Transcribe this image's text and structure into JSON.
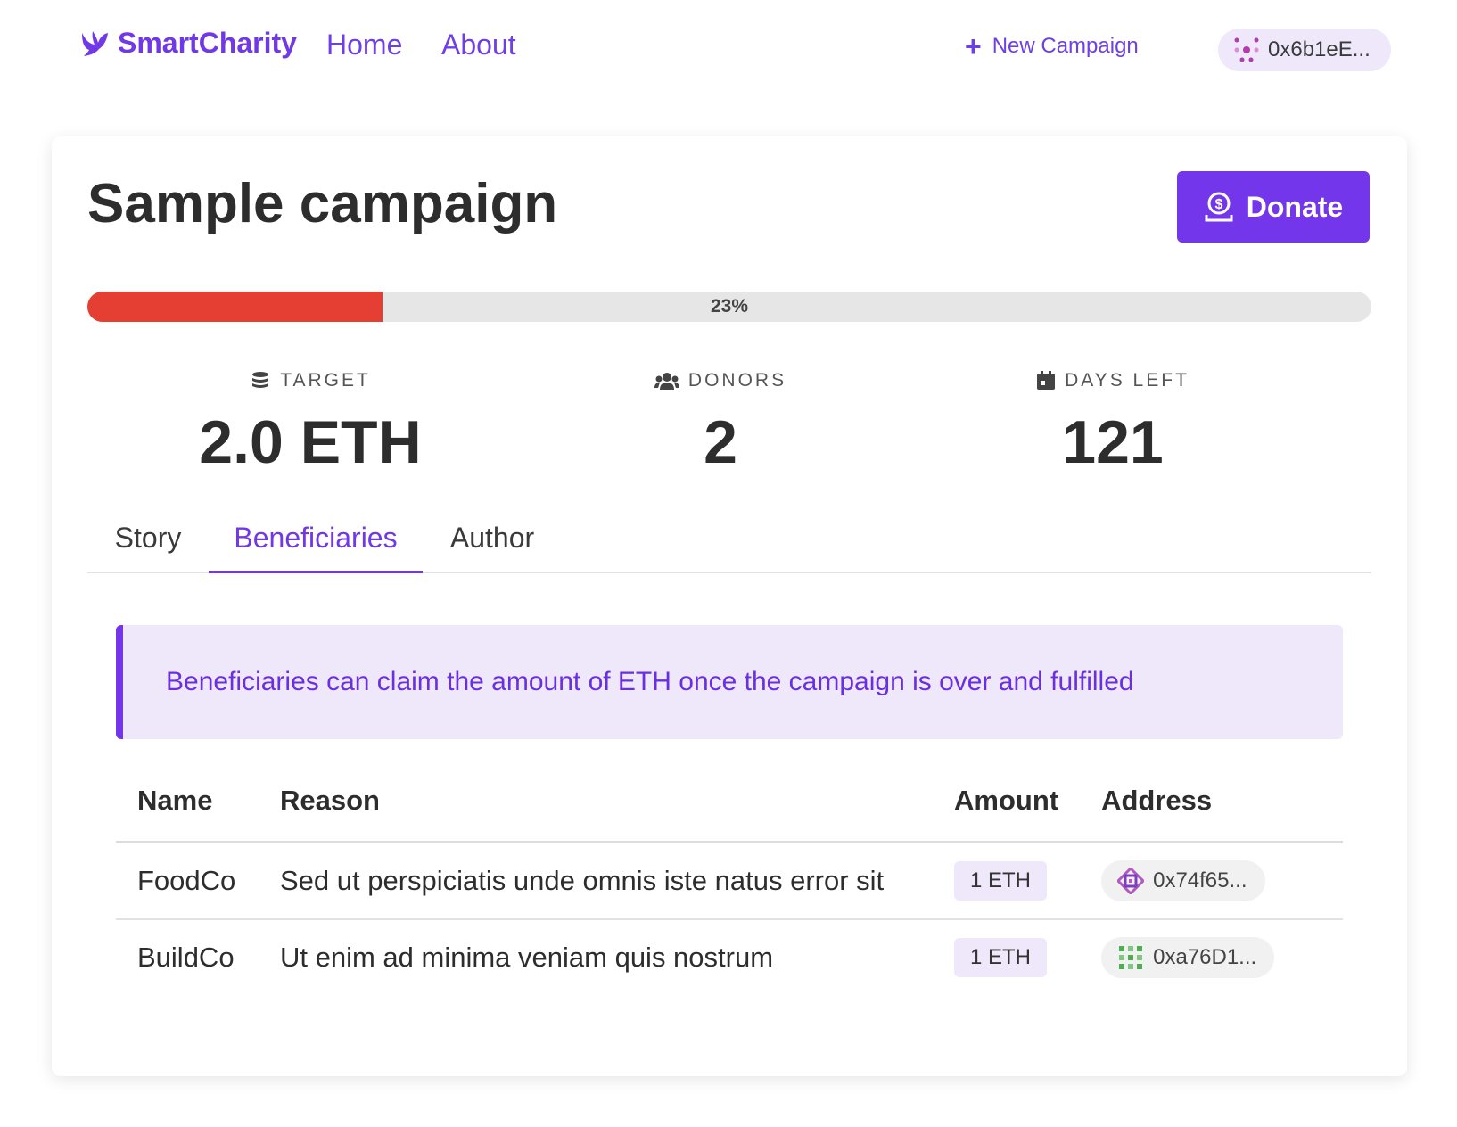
{
  "nav": {
    "brand": "SmartCharity",
    "links": [
      "Home",
      "About"
    ],
    "new_campaign": "New Campaign",
    "wallet": "0x6b1eE..."
  },
  "campaign": {
    "title": "Sample campaign",
    "donate_label": "Donate",
    "progress_percent": 23,
    "progress_label": "23%",
    "stats": [
      {
        "label": "TARGET",
        "value": "2.0 ETH"
      },
      {
        "label": "DONORS",
        "value": "2"
      },
      {
        "label": "DAYS LEFT",
        "value": "121"
      }
    ]
  },
  "tabs": [
    "Story",
    "Beneficiaries",
    "Author"
  ],
  "active_tab": "Beneficiaries",
  "alert": "Beneficiaries can claim the amount of ETH once the campaign is over and fulfilled",
  "table": {
    "headers": [
      "Name",
      "Reason",
      "Amount",
      "Address"
    ],
    "rows": [
      {
        "name": "FoodCo",
        "reason": "Sed ut perspiciatis unde omnis iste natus error sit",
        "amount": "1 ETH",
        "address": "0x74f65..."
      },
      {
        "name": "BuildCo",
        "reason": "Ut enim ad minima veniam quis nostrum",
        "amount": "1 ETH",
        "address": "0xa76D1..."
      }
    ]
  },
  "colors": {
    "accent": "#7436ea",
    "progress": "#e53e33",
    "alert_bg": "#efe8fb"
  }
}
